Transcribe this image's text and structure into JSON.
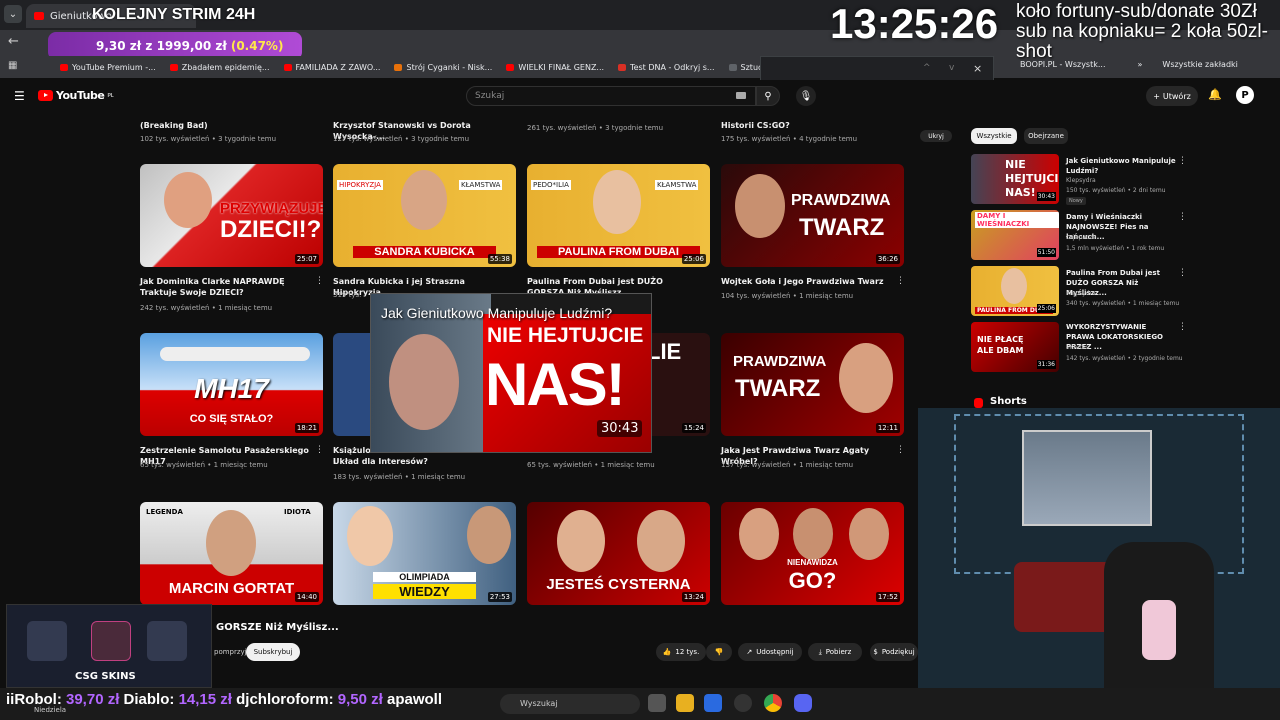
{
  "browser": {
    "tab_title": "Gieniutkowo",
    "stream_title": "KOLEJNY STRIM 24H",
    "donation_goal": "9,30 zł z 1999,00 zł",
    "donation_pct": "(0.47%)",
    "bookmarks": [
      "YouTube Premium -...",
      "Zbadałem epidemię...",
      "FAMILIADA Z ZAWO...",
      "Strój Cyganki - Nisk...",
      "WIELKI FINAŁ GENZ...",
      "Test DNA - Odkryj s...",
      "Sztuczny blus"
    ],
    "bookmarks_right": [
      "BOOPI.PL - Wszystk...",
      "Wszystkie zakładki"
    ]
  },
  "overlay": {
    "clock": "13:25:26",
    "promo": "koło fortuny-sub/donate 30Zł sub na kopniaku= 2 koła 50zl-shot"
  },
  "youtube": {
    "logo": "YouTube",
    "logo_suffix": "PL",
    "search_placeholder": "Szukaj",
    "create_label": "Utwórz",
    "avatar_letter": "P"
  },
  "top_row_meta": [
    {
      "title": "(Breaking Bad)",
      "meta": "102 tys. wyświetleń • 3 tygodnie temu"
    },
    {
      "title": "Krzysztof Stanowski vs Dorota Wysocka-...",
      "meta": "127 tys. wyświetleń • 3 tygodnie temu"
    },
    {
      "title": "",
      "meta": "261 tys. wyświetleń • 3 tygodnie temu"
    },
    {
      "title": "Historii CS:GO?",
      "meta": "175 tys. wyświetleń • 4 tygodnie temu"
    }
  ],
  "videos_row1": [
    {
      "thumb_text_top": "PRZYWIĄZUJE",
      "thumb_text": "DZIECI!?",
      "duration": "25:07",
      "title": "Jak Dominika Clarke NAPRAWDĘ Traktuje Swoje DZIECI?",
      "meta": "242 tys. wyświetleń • 1 miesiąc temu"
    },
    {
      "thumb_text": "SANDRA KUBICKA",
      "duration": "55:38",
      "title": "Sandra Kubicka i jej Straszna Hipokryzja",
      "meta": "319 tys."
    },
    {
      "thumb_text": "PAULINA FROM DUBAI",
      "duration": "25:06",
      "title": "Paulina From Dubai jest DUŻO GORSZA Niż Myśliszz...",
      "meta": ""
    },
    {
      "thumb_text_top": "PRAWDZIWA",
      "thumb_text": "TWARZ",
      "duration": "36:26",
      "title": "Wojtek Goła i Jego Prawdziwa Twarz",
      "meta": "104 tys. wyświetleń • 1 miesiąc temu"
    }
  ],
  "videos_row2": [
    {
      "thumb_text": "MH17",
      "thumb_sub": "CO SIĘ STAŁO?",
      "duration": "18:21",
      "title": "Zestrzelenie Samolotu Pasażerskiego MH17",
      "meta": "65 tys. wyświetleń • 1 miesiąc temu"
    },
    {
      "thumb_text": "",
      "duration": "",
      "title": "Książulo i ... Układ dla Interesów?",
      "meta": "183 tys. wyświetleń • 1 miesiąc temu"
    },
    {
      "thumb_text": "LIE",
      "duration": "15:24",
      "title": "...",
      "meta": "65 tys. wyświetleń • 1 miesiąc temu"
    },
    {
      "thumb_text_top": "PRAWDZIWA",
      "thumb_text": "TWARZ",
      "duration": "12:11",
      "title": "Jaka Jest Prawdziwa Twarz Agaty Wróbel?",
      "meta": "137 tys. wyświetleń • 1 miesiąc temu"
    }
  ],
  "videos_row3": [
    {
      "thumb_label_left": "LEGENDA",
      "thumb_label_right": "IDIOTA",
      "thumb_text": "MARCIN GORTAT",
      "duration": "14:40"
    },
    {
      "thumb_text_top": "OLIMPIADA",
      "thumb_text": "WIEDZY",
      "duration": "27:53"
    },
    {
      "thumb_text": "JESTEŚ CYSTERNA",
      "duration": "13:24"
    },
    {
      "thumb_text_top": "NIENAWIDZA",
      "thumb_text": "GO?",
      "duration": "17:52"
    }
  ],
  "side_panel": {
    "hide": "Ukryj",
    "chips": [
      "Wszystkie",
      "Obejrzane"
    ],
    "items": [
      {
        "title": "Jak Gieniutkowo Manipuluje Ludźmi?",
        "channel": "Klepsydra",
        "meta": "150 tys. wyświetleń • 2 dni temu",
        "badge": "Nowy",
        "thumb_text": "NIE HEJTUJCIE NAS!",
        "duration": "30:43"
      },
      {
        "title": "Damy i Wieśniaczki NAJNOWSZE! Pies na łańcuch...",
        "channel": "cojapacze",
        "meta": "1,5 mln wyświetleń • 1 rok temu",
        "thumb_text": "DAMY I WIEŚNIACZKI",
        "duration": "51:50"
      },
      {
        "title": "Paulina From Dubai jest DUŻO GORSZA Niż Myśliszz...",
        "channel": "Klepsydra",
        "meta": "340 tys. wyświetleń • 1 miesiąc temu",
        "thumb_text": "PAULINA FROM DUBAI",
        "duration": "25:06"
      },
      {
        "title": "WYKORZYSTYWANIE PRAWA LOKATORSKIEGO PRZEZ ...",
        "channel": "eKretes",
        "meta": "142 tys. wyświetleń • 2 tygodnie temu",
        "thumb_text": "NIE PŁACĘ ALE DBAM",
        "duration": "31:36"
      }
    ],
    "shorts_label": "Shorts"
  },
  "miniplayer": {
    "title": "Jak Gieniutkowo Manipuluje Ludźmi?",
    "thumb_text_top": "NIE HEJTUJCIE",
    "thumb_text": "NAS!",
    "time": "30:43"
  },
  "action_bar": {
    "video_title": "GORSZE Niż Myślisz...",
    "support_label": "pomprzyj",
    "subscribe": "Subskrybuj",
    "likes": "12 tys.",
    "share": "Udostępnij",
    "download": "Pobierz",
    "thanks": "Podziękuj"
  },
  "ticker": {
    "entries": [
      {
        "name": "iiRobol:",
        "amount": "39,70 zł"
      },
      {
        "name": "Diablo:",
        "amount": "14,15 zł"
      },
      {
        "name": "djchloroform:",
        "amount": "9,50 zł"
      },
      {
        "name": "apawoll",
        "amount": ""
      }
    ],
    "sponsor": "CSG SKINS",
    "day": "Niedziela"
  },
  "taskbar": {
    "search_placeholder": "Wyszukaj"
  },
  "colors": {
    "yt_red": "#ff0000",
    "purple": "#a64bd6",
    "ticker_amount": "#b266ff",
    "bg": "#0f0f0f"
  }
}
